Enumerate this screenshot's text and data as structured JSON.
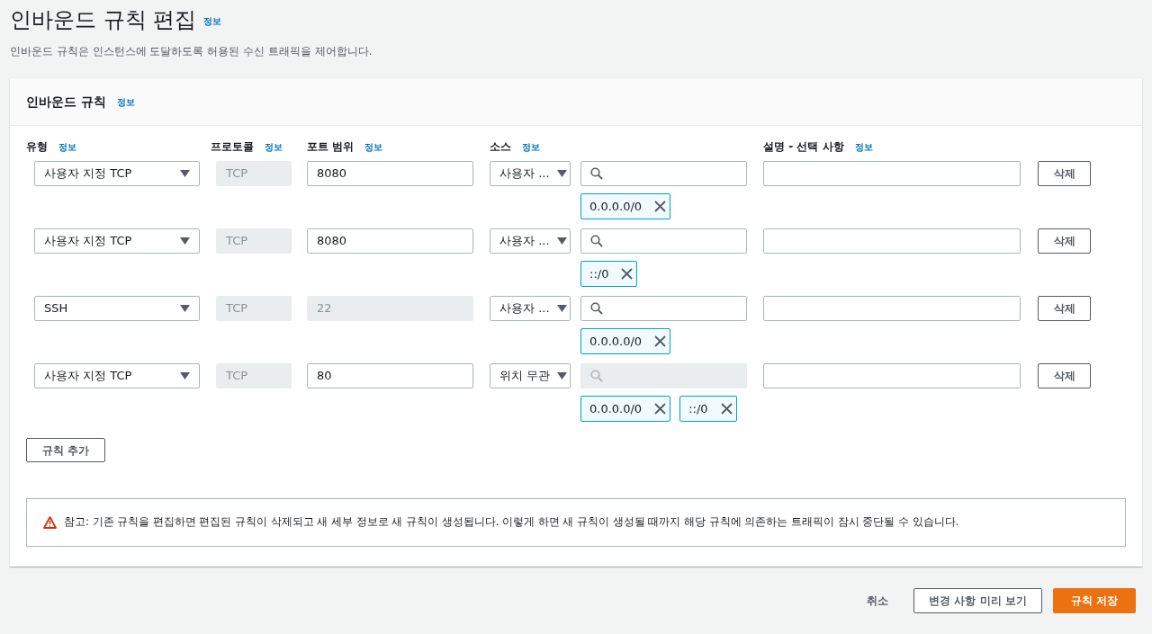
{
  "page": {
    "title": "인바운드 규칙 편집",
    "title_info": "정보",
    "description": "인바운드 규칙은 인스턴스에 도달하도록 허용된 수신 트래픽을 제어합니다."
  },
  "panel": {
    "title": "인바운드 규칙",
    "info": "정보",
    "columns": [
      {
        "label": "유형",
        "info": "정보"
      },
      {
        "label": "프로토콜",
        "info": "정보"
      },
      {
        "label": "포트 범위",
        "info": "정보"
      },
      {
        "label": "소스",
        "info": "정보"
      },
      {
        "label": "설명 - 선택 사항",
        "info": "정보"
      }
    ],
    "rules": [
      {
        "type": "사용자 지정 TCP",
        "protocol": "TCP",
        "port": "8080",
        "port_disabled": false,
        "source": "사용자 ...",
        "search_disabled": false,
        "cidrs": [
          "0.0.0.0/0"
        ],
        "delete": "삭제"
      },
      {
        "type": "사용자 지정 TCP",
        "protocol": "TCP",
        "port": "8080",
        "port_disabled": false,
        "source": "사용자 ...",
        "search_disabled": false,
        "cidrs": [
          "::/0"
        ],
        "delete": "삭제"
      },
      {
        "type": "SSH",
        "protocol": "TCP",
        "port": "22",
        "port_disabled": true,
        "source": "사용자 ...",
        "search_disabled": false,
        "cidrs": [
          "0.0.0.0/0"
        ],
        "delete": "삭제"
      },
      {
        "type": "사용자 지정 TCP",
        "protocol": "TCP",
        "port": "80",
        "port_disabled": false,
        "source": "위치 무관",
        "search_disabled": true,
        "cidrs": [
          "0.0.0.0/0",
          "::/0"
        ],
        "delete": "삭제"
      }
    ],
    "add_rule": "규칙 추가",
    "warning": "참고: 기존 규칙을 편집하면 편집된 규칙이 삭제되고 새 세부 정보로 새 규칙이 생성됩니다. 이렇게 하면 새 규칙이 생성될 때까지 해당 규칙에 의존하는 트래픽이 잠시 중단될 수 있습니다."
  },
  "footer": {
    "cancel": "취소",
    "preview": "변경 사항 미리 보기",
    "save": "규칙 저장"
  }
}
